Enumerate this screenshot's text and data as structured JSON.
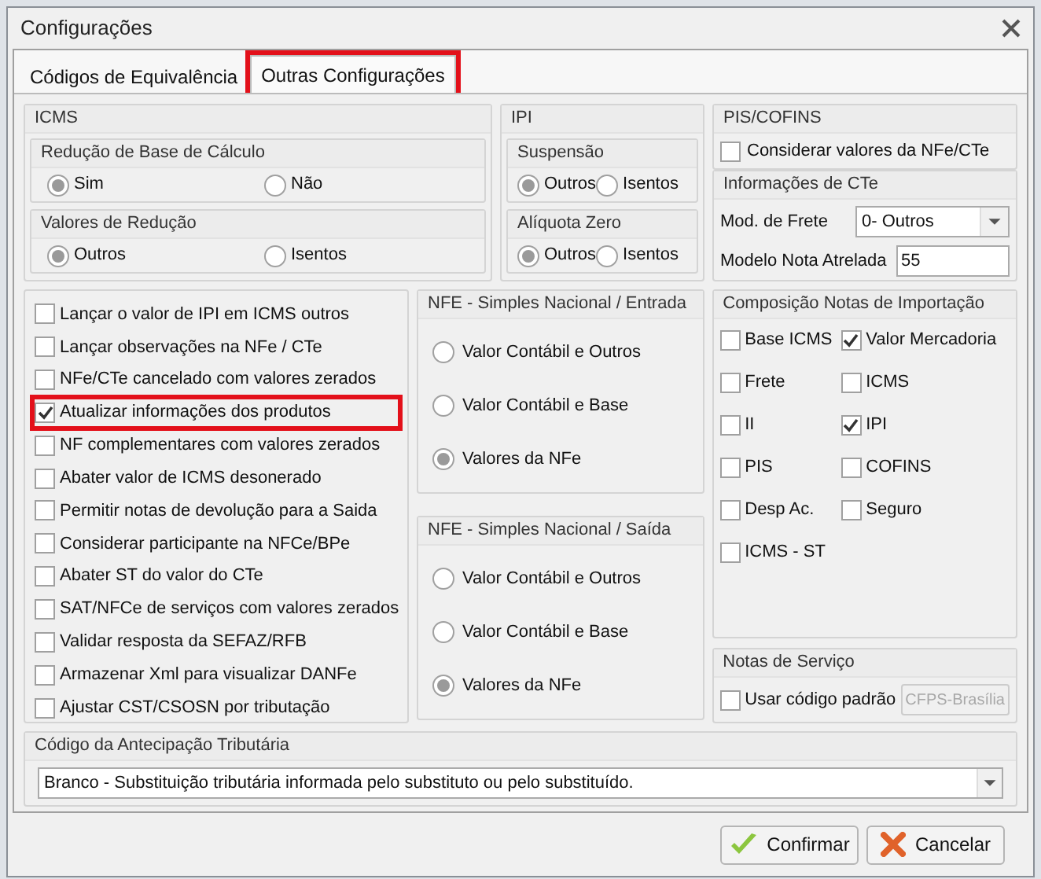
{
  "window": {
    "title": "Configurações"
  },
  "tabs": [
    {
      "label": "Códigos de Equivalência",
      "selected": false,
      "highlighted": false
    },
    {
      "label": "Outras Configurações",
      "selected": true,
      "highlighted": true
    }
  ],
  "icms": {
    "title": "ICMS",
    "groups": [
      {
        "title": "Redução de Base de Cálculo",
        "options": [
          {
            "label": "Sim",
            "selected": true
          },
          {
            "label": "Não",
            "selected": false
          }
        ]
      },
      {
        "title": "Valores de Redução",
        "options": [
          {
            "label": "Outros",
            "selected": true
          },
          {
            "label": "Isentos",
            "selected": false
          }
        ]
      }
    ]
  },
  "ipi": {
    "title": "IPI",
    "groups": [
      {
        "title": "Suspensão",
        "options": [
          {
            "label": "Outros",
            "selected": true
          },
          {
            "label": "Isentos",
            "selected": false
          }
        ]
      },
      {
        "title": "Alíquota Zero",
        "options": [
          {
            "label": "Outros",
            "selected": true
          },
          {
            "label": "Isentos",
            "selected": false
          }
        ]
      }
    ]
  },
  "pis_cofins": {
    "title": "PIS/COFINS",
    "checkbox": {
      "label": "Considerar valores da NFe/CTe",
      "checked": false
    }
  },
  "cte": {
    "title": "Informações de CTe",
    "fields": [
      {
        "kind": "select",
        "label": "Mod. de Frete",
        "value": "0- Outros"
      },
      {
        "kind": "text",
        "label": "Modelo Nota Atrelada",
        "value": "55"
      }
    ]
  },
  "options": [
    {
      "label": "Lançar o valor de IPI em ICMS outros",
      "checked": false,
      "highlighted": false
    },
    {
      "label": "Lançar observações na NFe / CTe",
      "checked": false,
      "highlighted": false
    },
    {
      "label": "NFe/CTe cancelado com valores zerados",
      "checked": false,
      "highlighted": false
    },
    {
      "label": "Atualizar informações dos produtos",
      "checked": true,
      "highlighted": true
    },
    {
      "label": "NF complementares com valores zerados",
      "checked": false,
      "highlighted": false
    },
    {
      "label": "Abater valor de ICMS desonerado",
      "checked": false,
      "highlighted": false
    },
    {
      "label": "Permitir notas de devolução para a Saida",
      "checked": false,
      "highlighted": false
    },
    {
      "label": "Considerar participante na NFCe/BPe",
      "checked": false,
      "highlighted": false
    },
    {
      "label": "Abater ST do valor do CTe",
      "checked": false,
      "highlighted": false
    },
    {
      "label": "SAT/NFCe de serviços com valores zerados",
      "checked": false,
      "highlighted": false
    },
    {
      "label": "Validar resposta da SEFAZ/RFB",
      "checked": false,
      "highlighted": false
    },
    {
      "label": "Armazenar Xml para visualizar DANFe",
      "checked": false,
      "highlighted": false
    },
    {
      "label": "Ajustar CST/CSOSN por tributação",
      "checked": false,
      "highlighted": false
    }
  ],
  "simples_groups": [
    {
      "title": "NFE - Simples Nacional / Entrada",
      "options": [
        {
          "label": "Valor Contábil e Outros",
          "selected": false
        },
        {
          "label": "Valor Contábil e Base",
          "selected": false
        },
        {
          "label": "Valores da NFe",
          "selected": true
        }
      ]
    },
    {
      "title": "NFE - Simples Nacional / Saída",
      "options": [
        {
          "label": "Valor Contábil e Outros",
          "selected": false
        },
        {
          "label": "Valor Contábil e Base",
          "selected": false
        },
        {
          "label": "Valores da NFe",
          "selected": true
        }
      ]
    }
  ],
  "importacao": {
    "title": "Composição Notas de Importação",
    "items": [
      {
        "label": "Base ICMS",
        "checked": false
      },
      {
        "label": "Valor Mercadoria",
        "checked": true
      },
      {
        "label": "Frete",
        "checked": false
      },
      {
        "label": "ICMS",
        "checked": false
      },
      {
        "label": "II",
        "checked": false
      },
      {
        "label": "IPI",
        "checked": true
      },
      {
        "label": "PIS",
        "checked": false
      },
      {
        "label": "COFINS",
        "checked": false
      },
      {
        "label": "Desp Ac.",
        "checked": false
      },
      {
        "label": "Seguro",
        "checked": false
      },
      {
        "label": "ICMS - ST",
        "checked": false
      }
    ]
  },
  "servico": {
    "title": "Notas de Serviço",
    "checkbox": {
      "label": "Usar código padrão",
      "checked": false
    },
    "button": {
      "label": "CFPS-Brasília",
      "disabled": true
    }
  },
  "antecipacao": {
    "title": "Código da Antecipação Tributária",
    "value": "Branco - Substituição tributária informada pelo substituto ou pelo substituído."
  },
  "buttons": [
    {
      "kind": "confirm",
      "label": "Confirmar"
    },
    {
      "kind": "cancel",
      "label": "Cancelar"
    }
  ]
}
